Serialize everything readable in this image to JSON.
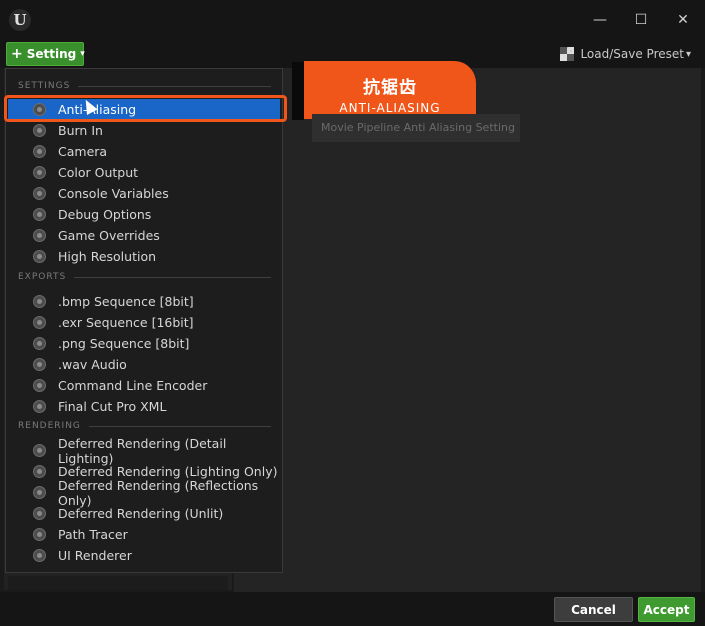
{
  "titlebar": {
    "logo_glyph": "U",
    "minimize_glyph": "—",
    "maximize_glyph": "☐",
    "close_glyph": "✕"
  },
  "toolbar": {
    "setting_plus": "+",
    "setting_label": "Setting",
    "setting_caret": "▾",
    "preset_label": "Load/Save Preset",
    "preset_caret": "▾"
  },
  "banner": {
    "title_cn": "抗锯齿",
    "title_en": "ANTI-ALIASING",
    "color": "#f0561a"
  },
  "tooltip": "Movie Pipeline Anti Aliasing Setting",
  "menu": {
    "sections": [
      {
        "title": "SETTINGS",
        "items": [
          "Anti-Aliasing",
          "Burn In",
          "Camera",
          "Color Output",
          "Console Variables",
          "Debug Options",
          "Game Overrides",
          "High Resolution"
        ]
      },
      {
        "title": "EXPORTS",
        "items": [
          ".bmp Sequence [8bit]",
          ".exr Sequence [16bit]",
          ".png Sequence [8bit]",
          ".wav Audio",
          "Command Line Encoder",
          "Final Cut Pro XML"
        ]
      },
      {
        "title": "RENDERING",
        "items": [
          "Deferred Rendering (Detail Lighting)",
          "Deferred Rendering (Lighting Only)",
          "Deferred Rendering (Reflections Only)",
          "Deferred Rendering (Unlit)",
          "Path Tracer",
          "UI Renderer"
        ]
      }
    ],
    "selected_item": "Anti-Aliasing"
  },
  "footer": {
    "cancel_label": "Cancel",
    "accept_label": "Accept"
  },
  "colors": {
    "accent_green": "#3a8f2d",
    "selection_blue": "#1966c8",
    "highlight_orange": "#f0561a"
  }
}
